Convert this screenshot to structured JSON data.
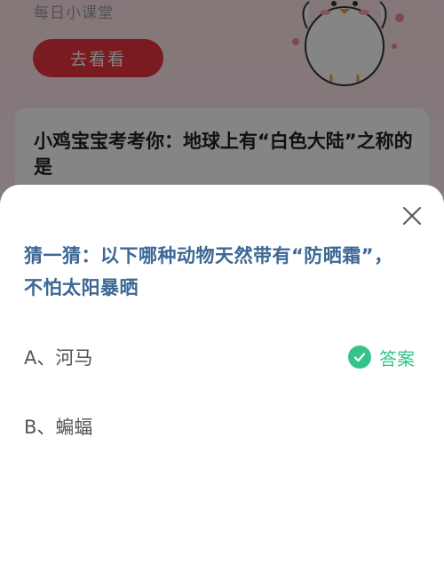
{
  "background": {
    "subtitle": "每日小课堂",
    "button_label": "去看看",
    "question": "小鸡宝宝考考你：地球上有“白色大陆”之称的是"
  },
  "sheet": {
    "question": "猜一猜：以下哪种动物天然带有“防晒霜”，不怕太阳暴晒",
    "options": [
      {
        "label": "A、河马",
        "is_answer": true
      },
      {
        "label": "B、蝙蝠",
        "is_answer": false
      }
    ],
    "answer_tag": "答案"
  },
  "colors": {
    "accent_red": "#e8343f",
    "question_blue": "#3d6796",
    "answer_green": "#35c38a"
  },
  "icons": [
    "close-icon",
    "check-icon",
    "chick-mascot"
  ]
}
